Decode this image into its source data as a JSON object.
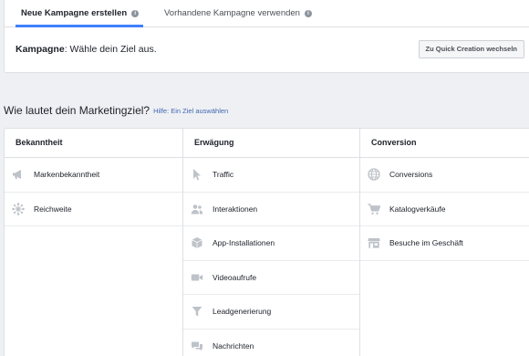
{
  "tabs": {
    "new_campaign": "Neue Kampagne erstellen",
    "existing_campaign": "Vorhandene Kampagne verwenden"
  },
  "campaign": {
    "label": "Kampagne",
    "text": ": Wähle dein Ziel aus.",
    "quick_creation_button": "Zu Quick Creation wechseln"
  },
  "question": {
    "text": "Wie lautet dein Marketingziel?",
    "help_link": "Hilfe: Ein Ziel auswählen"
  },
  "columns": {
    "awareness": {
      "title": "Bekanntheit",
      "items": [
        {
          "label": "Markenbekanntheit",
          "icon": "megaphone-icon"
        },
        {
          "label": "Reichweite",
          "icon": "reach-icon"
        }
      ]
    },
    "consideration": {
      "title": "Erwägung",
      "items": [
        {
          "label": "Traffic",
          "icon": "cursor-icon"
        },
        {
          "label": "Interaktionen",
          "icon": "people-icon"
        },
        {
          "label": "App-Installationen",
          "icon": "box-icon"
        },
        {
          "label": "Videoaufrufe",
          "icon": "video-camera-icon"
        },
        {
          "label": "Leadgenerierung",
          "icon": "funnel-icon"
        },
        {
          "label": "Nachrichten",
          "icon": "chat-bubbles-icon"
        }
      ]
    },
    "conversion": {
      "title": "Conversion",
      "items": [
        {
          "label": "Conversions",
          "icon": "globe-icon"
        },
        {
          "label": "Katalogverkäufe",
          "icon": "shopping-cart-icon"
        },
        {
          "label": "Besuche im Geschäft",
          "icon": "store-icon"
        }
      ]
    }
  },
  "colors": {
    "accent_blue": "#4080ff",
    "link_blue": "#4267b2",
    "icon_gray": "#bec3c9"
  }
}
